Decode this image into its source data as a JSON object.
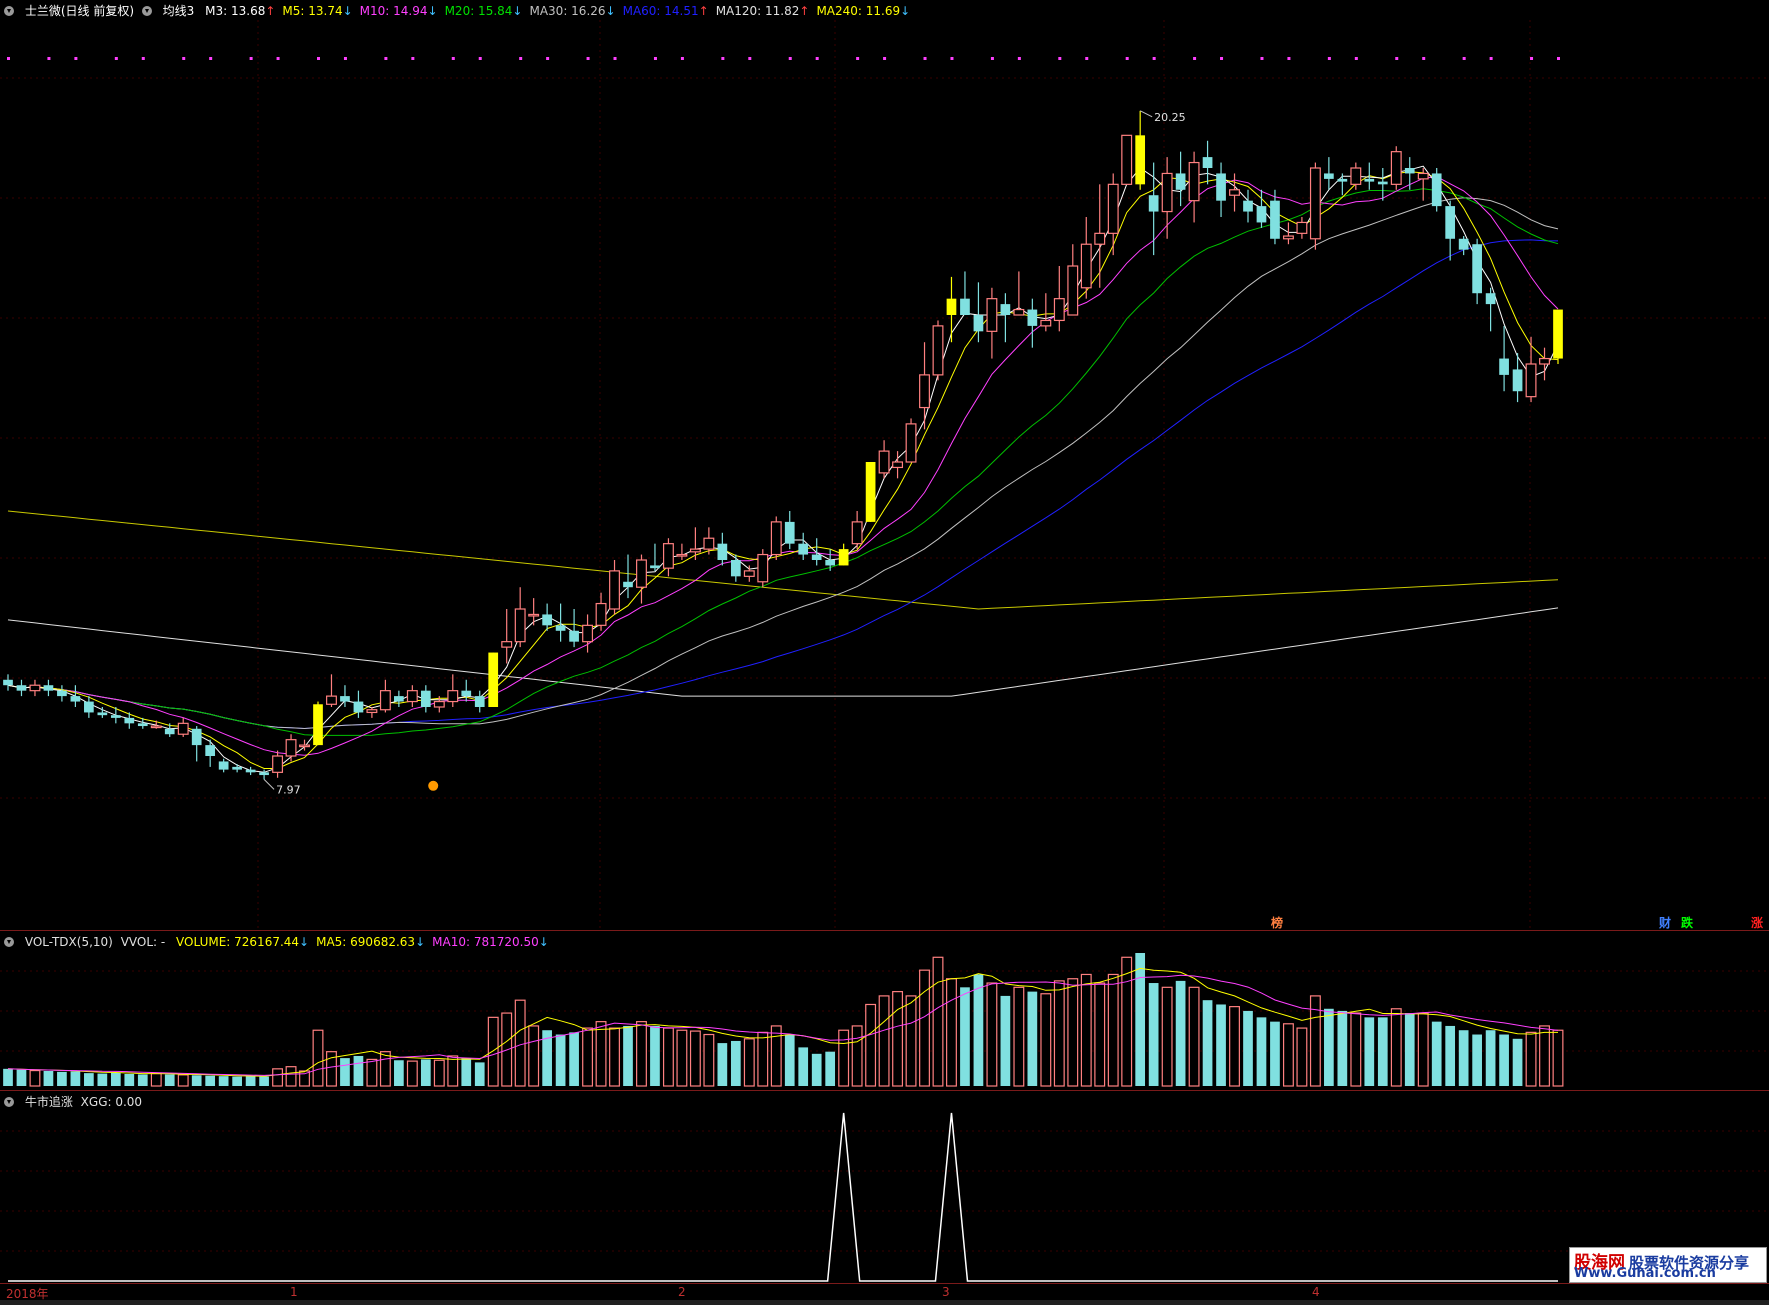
{
  "header": {
    "stock_name": "士兰微(日线 前复权)",
    "indicator": "均线3",
    "ma_items": [
      {
        "label": "M3: 13.68",
        "dir": "↑",
        "color": "#ffffff"
      },
      {
        "label": "M5: 13.74",
        "dir": "↓",
        "color": "#ffff00"
      },
      {
        "label": "M10: 14.94",
        "dir": "↓",
        "color": "#ff40ff"
      },
      {
        "label": "M20: 15.84",
        "dir": "↓",
        "color": "#00e000"
      },
      {
        "label": "MA30: 16.26",
        "dir": "↓",
        "color": "#c0c0c0"
      },
      {
        "label": "MA60: 14.51",
        "dir": "↑",
        "color": "#2020ff"
      },
      {
        "label": "MA120: 11.82",
        "dir": "↑",
        "color": "#e0e0e0"
      },
      {
        "label": "MA240: 11.69",
        "dir": "↓",
        "color": "#ffff00"
      }
    ]
  },
  "volume_header": {
    "name": "VOL-TDX(5,10)",
    "vvol": "VVOL: -",
    "items": [
      {
        "label": "VOLUME: 726167.44",
        "dir": "↓",
        "color": "#ffff00"
      },
      {
        "label": "MA5: 690682.63",
        "dir": "↓",
        "color": "#ffff00"
      },
      {
        "label": "MA10: 781720.50",
        "dir": "↓",
        "color": "#ff40ff"
      }
    ]
  },
  "xgg_header": {
    "name": "牛市追涨",
    "value": "XGG: 0.00"
  },
  "annotations": {
    "high": "20.25",
    "low": "7.97"
  },
  "tags": [
    {
      "text": "榜",
      "color": "#ff8040"
    },
    {
      "text": "财",
      "color": "#4080ff"
    },
    {
      "text": "跌",
      "color": "#00ff00"
    },
    {
      "text": "涨",
      "color": "#ff2020"
    }
  ],
  "xaxis_labels": [
    "2018年",
    "1",
    "2",
    "3",
    "4"
  ],
  "watermark": {
    "line1": "股海网",
    "line1b": "股票软件资源分享",
    "line2": "Www.Guhai.com.cn"
  },
  "colors": {
    "up": "#ff8080",
    "down": "#80e0e0",
    "signal": "#ffff00",
    "ma240": "#c8c800",
    "ma120": "#e0e0e0",
    "ma60": "#2020ff"
  },
  "chart_data": {
    "type": "candlestick",
    "title": "士兰微(日线 前复权)",
    "price_range": [
      7.5,
      21.0
    ],
    "grid": true,
    "candles": [
      [
        9.8,
        9.9,
        9.6,
        9.7
      ],
      [
        9.7,
        9.8,
        9.5,
        9.6
      ],
      [
        9.6,
        9.8,
        9.5,
        9.7
      ],
      [
        9.7,
        9.8,
        9.5,
        9.6
      ],
      [
        9.6,
        9.7,
        9.4,
        9.5
      ],
      [
        9.5,
        9.7,
        9.3,
        9.4
      ],
      [
        9.4,
        9.5,
        9.1,
        9.2
      ],
      [
        9.2,
        9.3,
        9.1,
        9.15
      ],
      [
        9.15,
        9.3,
        9.0,
        9.1
      ],
      [
        9.1,
        9.2,
        8.9,
        9.0
      ],
      [
        9.0,
        9.1,
        8.9,
        8.95
      ],
      [
        8.95,
        9.05,
        8.9,
        8.95
      ],
      [
        8.9,
        9.0,
        8.75,
        8.8
      ],
      [
        8.8,
        9.1,
        8.75,
        9.0
      ],
      [
        8.9,
        8.95,
        8.3,
        8.6
      ],
      [
        8.6,
        8.7,
        8.2,
        8.4
      ],
      [
        8.3,
        8.35,
        8.1,
        8.15
      ],
      [
        8.2,
        8.25,
        8.1,
        8.15
      ],
      [
        8.15,
        8.2,
        8.05,
        8.1
      ],
      [
        8.1,
        8.15,
        7.97,
        8.05
      ],
      [
        8.1,
        8.5,
        8.0,
        8.4
      ],
      [
        8.4,
        8.8,
        8.3,
        8.7
      ],
      [
        8.6,
        8.7,
        8.5,
        8.6
      ],
      [
        8.6,
        9.4,
        8.6,
        9.35
      ],
      [
        9.35,
        9.9,
        9.3,
        9.5
      ],
      [
        9.5,
        9.7,
        9.3,
        9.4
      ],
      [
        9.4,
        9.6,
        9.1,
        9.2
      ],
      [
        9.2,
        9.3,
        9.1,
        9.25
      ],
      [
        9.25,
        9.8,
        9.2,
        9.6
      ],
      [
        9.5,
        9.6,
        9.3,
        9.4
      ],
      [
        9.4,
        9.7,
        9.3,
        9.6
      ],
      [
        9.6,
        9.7,
        9.2,
        9.3
      ],
      [
        9.3,
        9.5,
        9.2,
        9.4
      ],
      [
        9.4,
        9.9,
        9.3,
        9.6
      ],
      [
        9.6,
        9.8,
        9.4,
        9.5
      ],
      [
        9.5,
        9.6,
        9.2,
        9.3
      ],
      [
        9.3,
        10.3,
        9.3,
        10.3
      ],
      [
        10.4,
        11.1,
        10.1,
        10.5
      ],
      [
        10.5,
        11.5,
        10.4,
        11.1
      ],
      [
        11.0,
        11.3,
        10.8,
        11.0
      ],
      [
        11.0,
        11.2,
        10.7,
        10.8
      ],
      [
        10.8,
        11.2,
        10.5,
        10.7
      ],
      [
        10.7,
        11.1,
        10.4,
        10.5
      ],
      [
        10.5,
        11.0,
        10.3,
        10.8
      ],
      [
        10.8,
        11.4,
        10.7,
        11.2
      ],
      [
        11.1,
        12.0,
        11.0,
        11.8
      ],
      [
        11.6,
        12.1,
        11.3,
        11.5
      ],
      [
        11.5,
        12.1,
        11.2,
        12.0
      ],
      [
        11.9,
        12.3,
        11.8,
        11.85
      ],
      [
        11.85,
        12.4,
        11.7,
        12.3
      ],
      [
        12.1,
        12.3,
        12.0,
        12.1
      ],
      [
        12.15,
        12.6,
        12.0,
        12.2
      ],
      [
        12.2,
        12.6,
        12.1,
        12.4
      ],
      [
        12.3,
        12.5,
        11.9,
        12.0
      ],
      [
        12.0,
        12.1,
        11.6,
        11.7
      ],
      [
        11.7,
        11.9,
        11.6,
        11.8
      ],
      [
        11.6,
        12.2,
        11.5,
        12.1
      ],
      [
        12.1,
        12.8,
        12.0,
        12.7
      ],
      [
        12.7,
        12.9,
        12.2,
        12.3
      ],
      [
        12.3,
        12.5,
        12.0,
        12.1
      ],
      [
        12.1,
        12.4,
        11.9,
        12.0
      ],
      [
        12.0,
        12.2,
        11.8,
        11.9
      ],
      [
        11.9,
        12.3,
        11.9,
        12.2
      ],
      [
        12.3,
        12.9,
        12.2,
        12.7
      ],
      [
        12.7,
        13.8,
        12.7,
        13.8
      ],
      [
        13.6,
        14.2,
        13.5,
        14.0
      ],
      [
        13.7,
        14.0,
        13.5,
        13.8
      ],
      [
        13.8,
        14.6,
        13.8,
        14.5
      ],
      [
        14.8,
        16.0,
        14.4,
        15.4
      ],
      [
        15.4,
        16.4,
        15.3,
        16.3
      ],
      [
        16.5,
        17.2,
        16.0,
        16.8
      ],
      [
        16.8,
        17.3,
        16.5,
        16.5
      ],
      [
        16.5,
        17.1,
        16.0,
        16.2
      ],
      [
        16.2,
        17.0,
        15.7,
        16.8
      ],
      [
        16.7,
        16.9,
        16.0,
        16.5
      ],
      [
        16.5,
        17.3,
        16.5,
        16.6
      ],
      [
        16.6,
        16.8,
        15.9,
        16.3
      ],
      [
        16.3,
        16.9,
        16.2,
        16.4
      ],
      [
        16.4,
        17.4,
        16.2,
        16.8
      ],
      [
        16.5,
        17.8,
        16.5,
        17.4
      ],
      [
        17.0,
        18.3,
        16.8,
        17.8
      ],
      [
        17.8,
        18.9,
        17.0,
        18.0
      ],
      [
        18.0,
        19.1,
        17.6,
        18.9
      ],
      [
        18.9,
        19.8,
        18.9,
        19.8
      ],
      [
        19.8,
        20.25,
        18.8,
        18.9
      ],
      [
        18.7,
        19.3,
        17.6,
        18.4
      ],
      [
        18.4,
        19.4,
        17.9,
        19.1
      ],
      [
        19.1,
        19.5,
        18.5,
        18.8
      ],
      [
        18.6,
        19.5,
        18.2,
        19.3
      ],
      [
        19.4,
        19.7,
        18.9,
        19.2
      ],
      [
        19.1,
        19.3,
        18.3,
        18.6
      ],
      [
        18.7,
        19.1,
        18.4,
        18.8
      ],
      [
        18.6,
        18.8,
        18.2,
        18.4
      ],
      [
        18.5,
        18.8,
        18.1,
        18.2
      ],
      [
        18.6,
        18.8,
        17.8,
        17.9
      ],
      [
        17.9,
        18.2,
        17.8,
        17.95
      ],
      [
        18.0,
        18.3,
        17.9,
        18.2
      ],
      [
        17.9,
        19.3,
        17.7,
        19.2
      ],
      [
        19.1,
        19.4,
        18.8,
        19.0
      ],
      [
        19.0,
        19.1,
        18.7,
        18.95
      ],
      [
        18.9,
        19.3,
        18.8,
        19.2
      ],
      [
        19.0,
        19.3,
        18.8,
        18.95
      ],
      [
        18.95,
        19.2,
        18.6,
        18.9
      ],
      [
        18.9,
        19.6,
        18.8,
        19.5
      ],
      [
        19.2,
        19.4,
        18.8,
        19.1
      ],
      [
        19.0,
        19.2,
        18.6,
        19.1
      ],
      [
        19.1,
        19.2,
        18.4,
        18.5
      ],
      [
        18.5,
        18.6,
        17.5,
        17.9
      ],
      [
        17.9,
        17.95,
        17.6,
        17.7
      ],
      [
        17.8,
        17.9,
        16.7,
        16.9
      ],
      [
        16.9,
        17.0,
        16.2,
        16.7
      ],
      [
        15.7,
        16.3,
        15.1,
        15.4
      ],
      [
        15.5,
        15.8,
        14.9,
        15.1
      ],
      [
        15.0,
        16.1,
        14.9,
        15.6
      ],
      [
        15.6,
        15.9,
        15.3,
        15.7
      ],
      [
        15.7,
        16.2,
        15.6,
        16.6
      ]
    ],
    "signal_candle_indices": [
      23,
      36,
      62,
      64,
      70,
      84,
      115
    ],
    "volume": [
      40,
      38,
      36,
      35,
      33,
      34,
      30,
      29,
      31,
      28,
      27,
      29,
      27,
      26,
      25,
      24,
      23,
      22,
      23,
      22,
      40,
      45,
      35,
      130,
      80,
      65,
      70,
      62,
      80,
      60,
      58,
      62,
      60,
      70,
      65,
      55,
      160,
      170,
      200,
      140,
      130,
      120,
      125,
      135,
      150,
      135,
      140,
      150,
      140,
      135,
      130,
      128,
      120,
      100,
      105,
      110,
      125,
      140,
      120,
      90,
      75,
      80,
      130,
      140,
      190,
      210,
      220,
      210,
      270,
      300,
      250,
      230,
      260,
      240,
      210,
      230,
      220,
      215,
      245,
      250,
      260,
      240,
      260,
      300,
      310,
      240,
      230,
      245,
      230,
      200,
      190,
      185,
      175,
      160,
      150,
      145,
      135,
      210,
      180,
      175,
      170,
      160,
      160,
      180,
      170,
      170,
      150,
      140,
      130,
      120,
      130,
      120,
      110,
      125,
      140,
      130
    ]
  }
}
